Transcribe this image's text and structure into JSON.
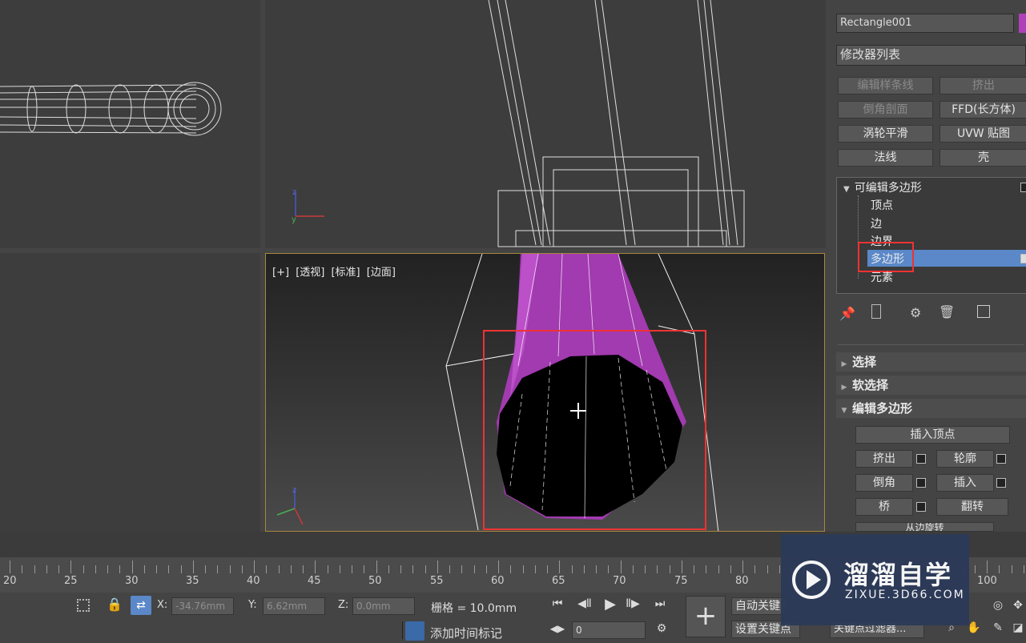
{
  "viewport_br": {
    "tag_plus": "[+]",
    "tag_view": "[透视]",
    "tag_shading": "[标准]",
    "tag_edges": "[边面]"
  },
  "panel": {
    "object_name": "Rectangle001",
    "modifier_list": "修改器列表",
    "buttons": [
      "编辑样条线",
      "挤出",
      "倒角剖面",
      "FFD(长方体)",
      "涡轮平滑",
      "UVW 贴图",
      "法线",
      "壳"
    ],
    "stack": {
      "root": "可编辑多边形",
      "items": [
        "顶点",
        "边",
        "边界",
        "多边形",
        "元素"
      ],
      "selected": "多边形"
    },
    "rollouts": {
      "select": "选择",
      "soft_select": "软选择",
      "edit_poly": "编辑多边形"
    },
    "edit": {
      "insert_vertex": "插入顶点",
      "extrude": "挤出",
      "outline": "轮廓",
      "bevel": "倒角",
      "inset": "插入",
      "bridge": "桥",
      "flip": "翻转",
      "next_partial": "从边旋转"
    }
  },
  "timeline": {
    "labels": [
      "20",
      "25",
      "30",
      "35",
      "40",
      "45",
      "50",
      "55",
      "60",
      "65",
      "70",
      "75",
      "80",
      "100"
    ]
  },
  "status": {
    "x_label": "X:",
    "x_value": "-34.76mm",
    "y_label": "Y:",
    "y_value": "6.62mm",
    "z_label": "Z:",
    "z_value": "0.0mm",
    "grid": "栅格 = 10.0mm",
    "add_time_tag": "添加时间标记",
    "auto_key": "自动关键",
    "set_key": "设置关键点",
    "key_filter": "关键点过滤器...",
    "frame_value": "0"
  },
  "watermark": {
    "title": "溜溜自学",
    "url": "ZIXUE.3D66.COM"
  },
  "colors": {
    "accent_select": "#5a88c8",
    "highlight_box": "#e33",
    "poly_magenta": "#a23ab0"
  }
}
